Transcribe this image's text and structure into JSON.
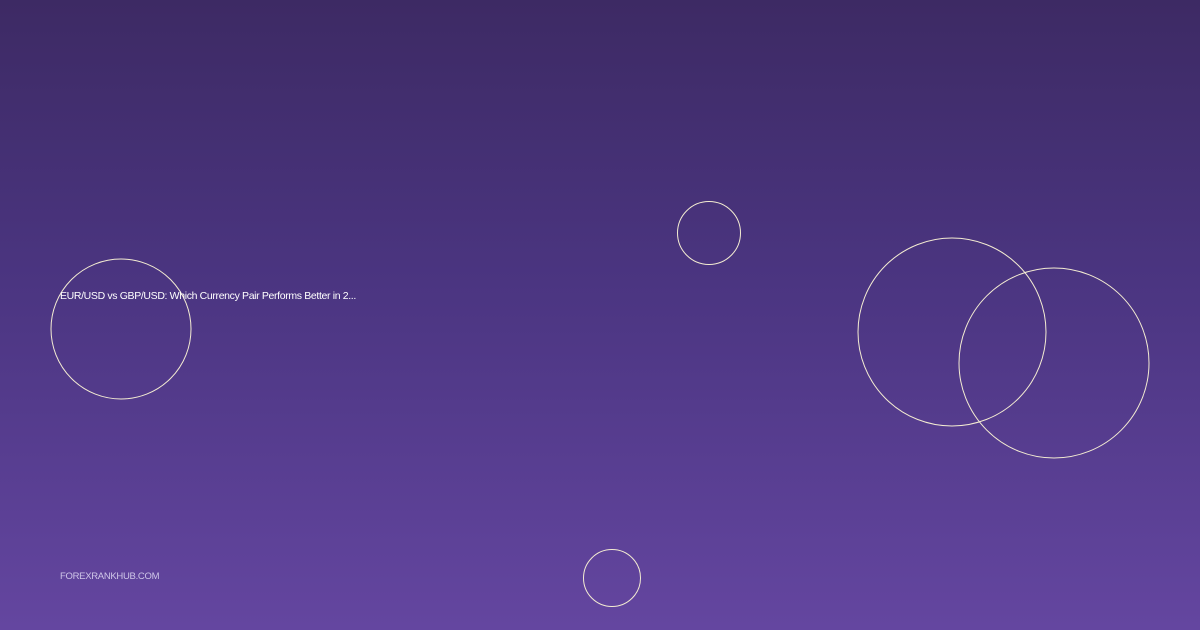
{
  "card": {
    "title": "EUR/USD vs GBP/USD: Which Currency Pair Performs Better in 2...",
    "site": "FOREXRANKHUB.COM"
  },
  "colors": {
    "gradient_top": "#3d2a64",
    "gradient_bottom": "#6446a0",
    "circle_stroke": "#f4ecd2",
    "title_text": "#ffffff",
    "site_text": "#cfc6e8"
  }
}
